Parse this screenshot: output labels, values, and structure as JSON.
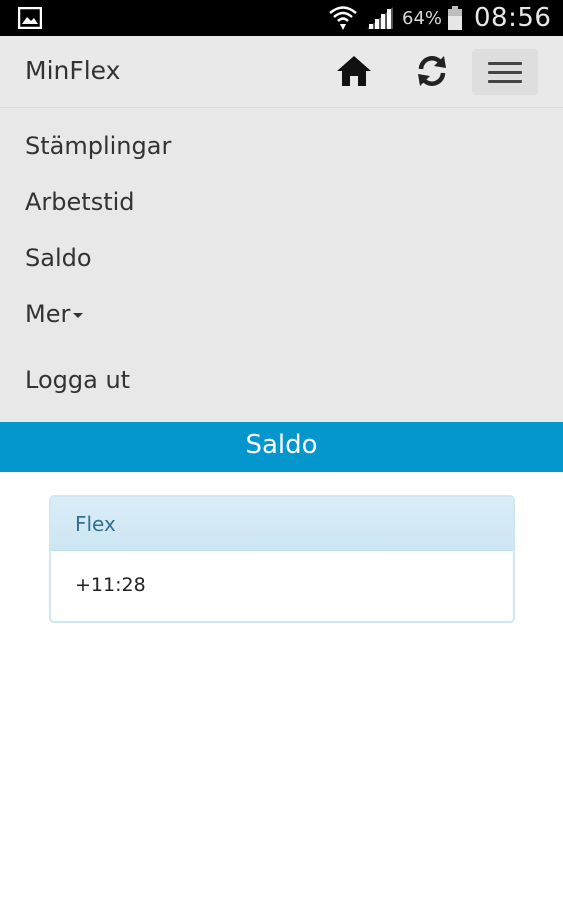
{
  "status_bar": {
    "battery_percent": "64%",
    "time": "08:56",
    "icons": [
      "gallery-notification-icon",
      "wifi-icon",
      "cell-signal-icon",
      "battery-icon"
    ]
  },
  "navbar": {
    "brand": "MinFlex",
    "icons": [
      "home-icon",
      "refresh-icon",
      "hamburger-menu-icon"
    ]
  },
  "menu": {
    "items": [
      {
        "label": "Stämplingar"
      },
      {
        "label": "Arbetstid"
      },
      {
        "label": "Saldo"
      },
      {
        "label": "Mer"
      },
      {
        "label": "Logga ut"
      }
    ]
  },
  "page": {
    "title": "Saldo",
    "accent_color": "#0397cd"
  },
  "panel": {
    "heading": "Flex",
    "value": "+11:28",
    "heading_color": "#d9edf7"
  }
}
